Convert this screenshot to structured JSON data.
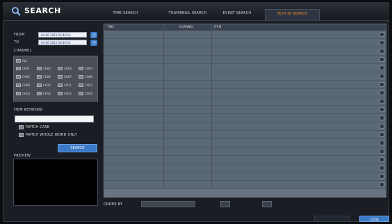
{
  "header": {
    "title": "SEARCH",
    "tabs": [
      {
        "label": "TIME SEARCH",
        "active": false
      },
      {
        "label": "THUMBNAIL SEARCH",
        "active": false
      },
      {
        "label": "EVENT SEARCH",
        "active": false
      },
      {
        "label": "TEXT-IN SEARCH",
        "active": true
      }
    ]
  },
  "filters": {
    "from_label": "FROM",
    "from_value": "04-06-2015 03:44:53",
    "to_label": "TO",
    "to_value": "04-06-2015 00:49:53",
    "channel_label": "CHANNEL",
    "all_label": "ALL",
    "channels": [
      "CH01",
      "CH02",
      "CH03",
      "CH04",
      "CH05",
      "CH06",
      "CH07",
      "CH08",
      "CH09",
      "CH10",
      "CH11",
      "CH12",
      "CH13",
      "CH14",
      "CH15",
      "CH16"
    ],
    "item_keyword_label": "ITEM KEYWORD",
    "keyword_value": "",
    "match_case_label": "MATCH CASE",
    "match_whole_label": "MATCH WHOLE WORD ONLY",
    "search_button": "SEARCH",
    "preview_label": "PREVIEW"
  },
  "table": {
    "columns": [
      "TIME",
      "CHANNEL",
      "ITEM"
    ],
    "rows_count": 20
  },
  "bottom": {
    "order_by_label": "ORDER BY",
    "prev_button": "",
    "next_button": "",
    "close_button": "CLOSE"
  },
  "colors": {
    "accent": "#3b7ac6",
    "active_tab": "#f08a2a",
    "selected_row": "#e08a2f"
  }
}
